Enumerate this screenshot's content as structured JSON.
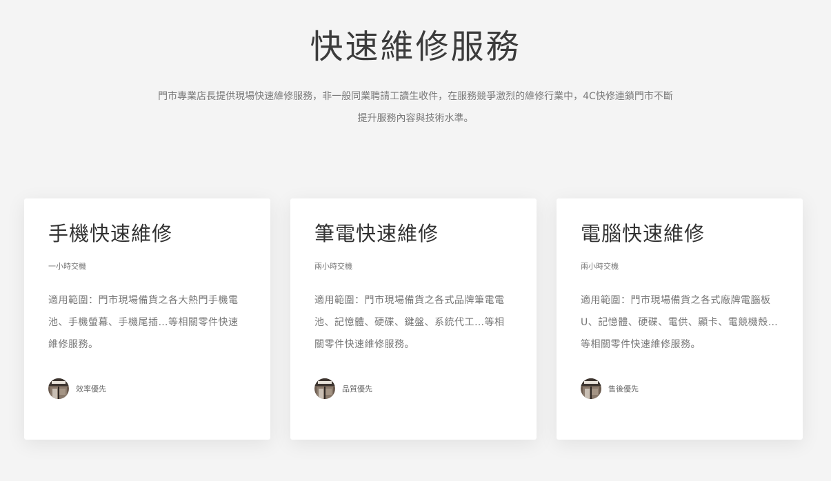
{
  "section": {
    "title": "快速維修服務",
    "intro": "門市專業店長提供現場快速維修服務，非一般同業聘請工讀生收件，在服務競爭激烈的維修行業中，4C快修連鎖門市不斷提升服務內容與技術水準。"
  },
  "cards": [
    {
      "title": "手機快速維修",
      "subtitle": "一小時交機",
      "description": "適用範圍：門市現場備貨之各大熱門手機電池、手機螢幕、手機尾插…等相關零件快速維修服務。",
      "footer_label": "效率優先"
    },
    {
      "title": "筆電快速維修",
      "subtitle": "兩小時交機",
      "description": "適用範圍：門市現場備貨之各式品牌筆電電池、記憶體、硬碟、鍵盤、系統代工…等相關零件快速維修服務。",
      "footer_label": "品質優先"
    },
    {
      "title": "電腦快速維修",
      "subtitle": "兩小時交機",
      "description": "適用範圍：門市現場備貨之各式廠牌電腦板U、記憶體、硬碟、電供、顯卡、電競機殼…等相關零件快速維修服務。",
      "footer_label": "售後優先"
    }
  ],
  "colors": {
    "background": "#f4f4f4",
    "card_background": "#ffffff",
    "title_text": "#3c3c3c",
    "muted_text": "#7a7a7a"
  },
  "icons": {
    "avatar": "storefront-photo-avatar"
  }
}
